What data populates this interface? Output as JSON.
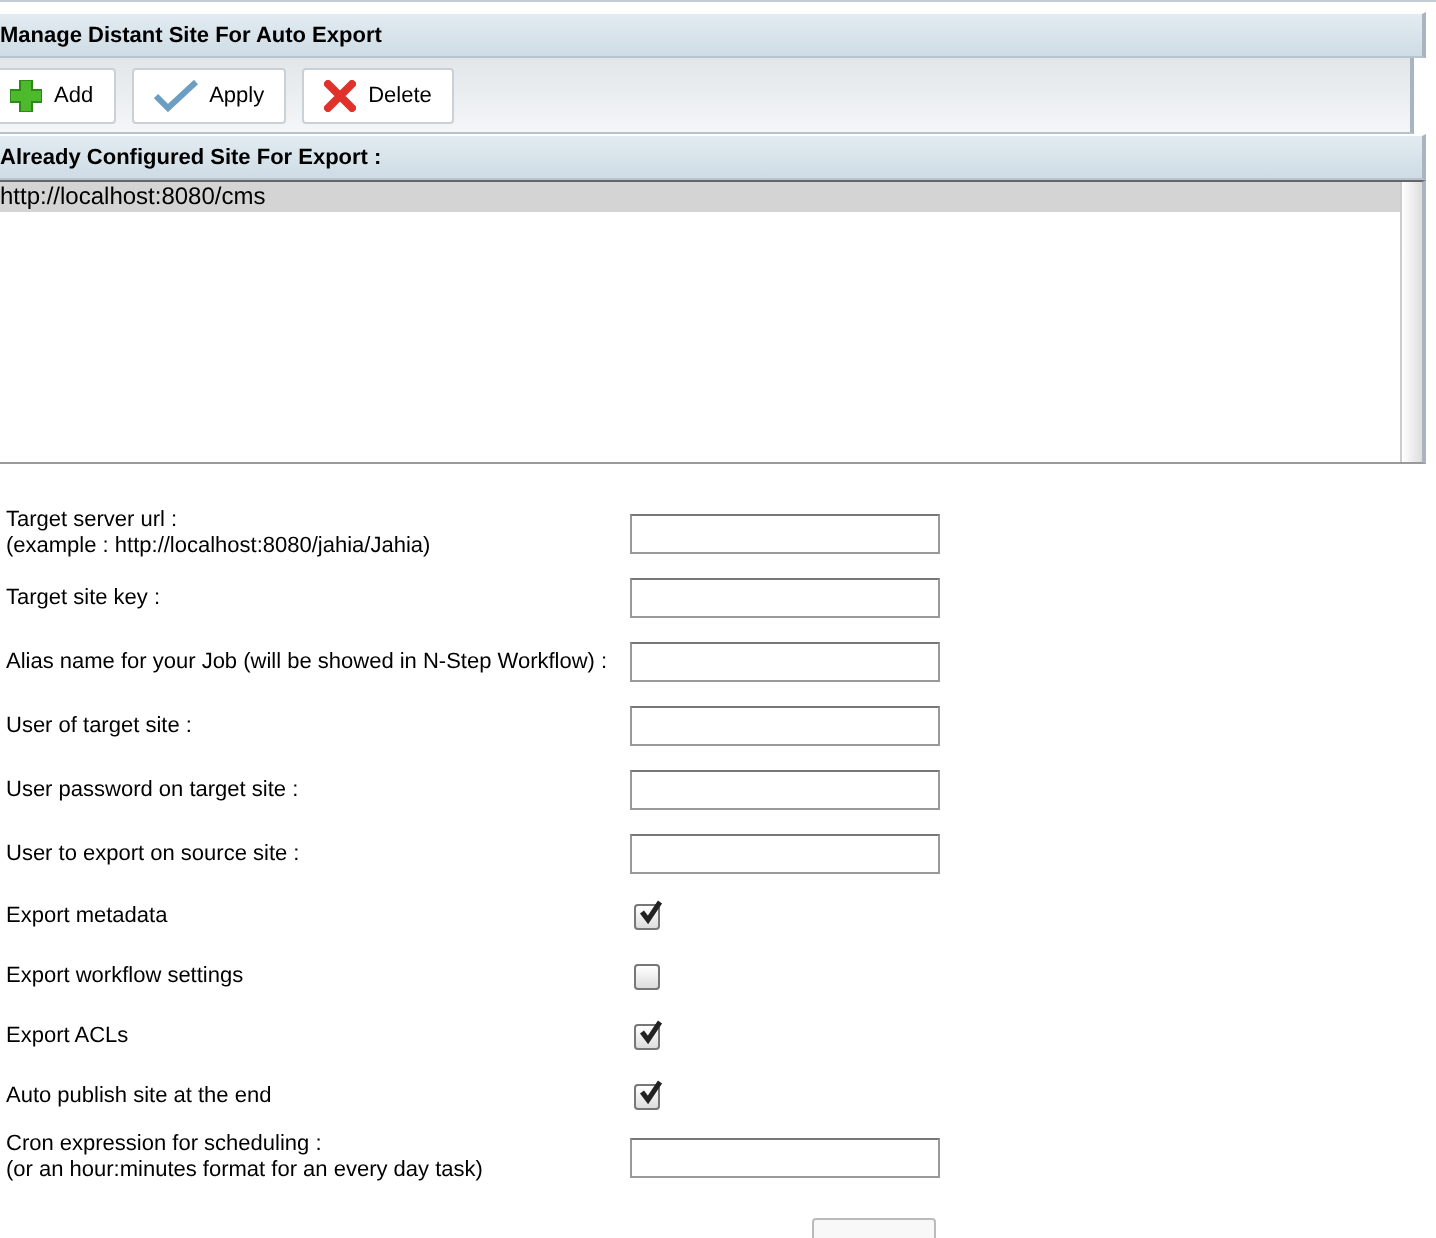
{
  "panel": {
    "title": "Manage Distant Site For Auto Export"
  },
  "toolbar": [
    {
      "kind": "add",
      "label": "Add"
    },
    {
      "kind": "apply",
      "label": "Apply"
    },
    {
      "kind": "delete",
      "label": "Delete"
    }
  ],
  "sites": {
    "title": "Already Configured Site For Export :",
    "items": [
      {
        "label": "http://localhost:8080/cms",
        "selected": true
      }
    ]
  },
  "form": [
    {
      "kind": "text",
      "label": "Target server url :",
      "hint": "(example : http://localhost:8080/jahia/Jahia)"
    },
    {
      "kind": "text",
      "label": "Target site key :"
    },
    {
      "kind": "text",
      "label": "Alias name for your Job (will be showed in N-Step Workflow) :"
    },
    {
      "kind": "text",
      "label": "User of target site :"
    },
    {
      "kind": "text",
      "label": "User password on target site :"
    },
    {
      "kind": "text",
      "label": "User to export on source site :"
    },
    {
      "kind": "check",
      "label": "Export metadata",
      "checked": true
    },
    {
      "kind": "check",
      "label": "Export workflow settings",
      "checked": false
    },
    {
      "kind": "check",
      "label": "Export ACLs",
      "checked": true
    },
    {
      "kind": "check",
      "label": "Auto publish site at the end",
      "checked": true
    },
    {
      "kind": "text",
      "label": "Cron expression for scheduling :",
      "hint": "(or an hour:minutes format for an every day task)"
    }
  ]
}
